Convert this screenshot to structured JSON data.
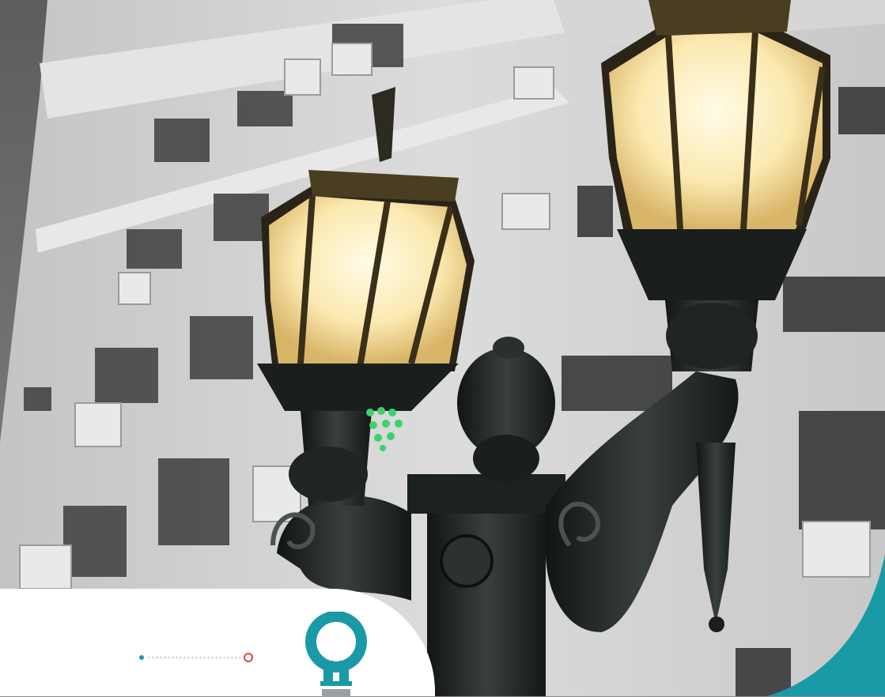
{
  "scene": {
    "subject": "street-lamp-photo",
    "colors": {
      "sky": "#6f6f6f",
      "building": "#cfcfcf",
      "lamp_glow": "#fff2c6",
      "lamp_metal": "#1f2422",
      "brand_teal": "#1a9aa6",
      "accent_red": "#e2463c",
      "led_green": "#39d36b"
    }
  },
  "brand": {
    "logo_icon": "lightbulb-ring-icon"
  },
  "progress": {
    "start_icon": "dot-icon",
    "end_icon": "ring-icon"
  }
}
